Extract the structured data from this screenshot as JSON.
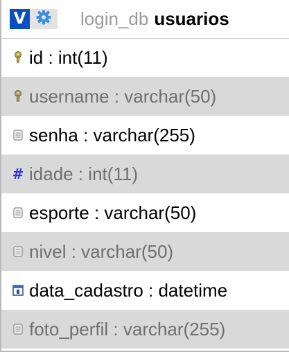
{
  "header": {
    "v_button_label": "V",
    "db_name": "login_db",
    "table_name": "usuarios"
  },
  "columns": [
    {
      "label": "id : int(11)",
      "icon": "key-icon"
    },
    {
      "label": "username : varchar(50)",
      "icon": "key-icon"
    },
    {
      "label": "senha : varchar(255)",
      "icon": "text-field-icon"
    },
    {
      "label": "idade : int(11)",
      "icon": "numeric-icon"
    },
    {
      "label": "esporte : varchar(50)",
      "icon": "text-field-icon"
    },
    {
      "label": "nivel : varchar(50)",
      "icon": "text-field-icon"
    },
    {
      "label": "data_cadastro : datetime",
      "icon": "datetime-icon"
    },
    {
      "label": "foto_perfil : varchar(255)",
      "icon": "text-field-icon"
    }
  ],
  "colors": {
    "brand_blue": "#0a4ec2",
    "row_shade": "#d9d9d9",
    "dim_text": "#6f6f6f",
    "numeric_icon": "#2f34d9"
  }
}
